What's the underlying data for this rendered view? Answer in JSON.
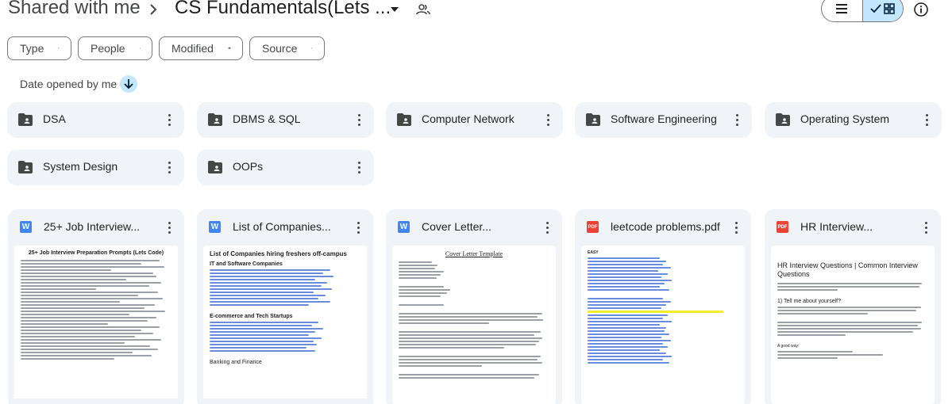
{
  "header": {
    "root": "Shared with me",
    "current": "CS Fundamentals(Lets ..."
  },
  "filters": [
    "Type",
    "People",
    "Modified",
    "Source"
  ],
  "sort": {
    "label": "Date opened by me"
  },
  "folders": [
    {
      "name": "DSA"
    },
    {
      "name": "DBMS & SQL"
    },
    {
      "name": "Computer Network"
    },
    {
      "name": "Software Engineering"
    },
    {
      "name": "Operating System"
    },
    {
      "name": "System Design"
    },
    {
      "name": "OOPs"
    }
  ],
  "files": [
    {
      "name": "25+ Job Interview...",
      "type": "doc",
      "type_label": "W",
      "thumb_title": "25+ Job Interview Preparation Prompts (Lets Code)"
    },
    {
      "name": "List of Companies...",
      "type": "doc",
      "type_label": "W",
      "thumb_title": "List of Companies hiring freshers off-campus",
      "thumb_sections": [
        "IT and Software Companies",
        "E-commerce and Tech Startups"
      ],
      "thumb_footer": "Banking and Finance"
    },
    {
      "name": "Cover Letter...",
      "type": "doc",
      "type_label": "W",
      "thumb_title": "Cover Letter Template"
    },
    {
      "name": "leetcode problems.pdf",
      "type": "pdf",
      "type_label": "PDF",
      "thumb_title": "EASY"
    },
    {
      "name": "HR Interview...",
      "type": "pdf",
      "type_label": "PDF",
      "thumb_title": "HR Interview Questions | Common Interview Questions",
      "thumb_q": "1) Tell me about yourself?",
      "thumb_good": "A good way:"
    }
  ],
  "colors": {
    "card_bg": "#f0f4f9",
    "selected": "#c2e7ff",
    "doc_icon": "#4285f4",
    "pdf_icon": "#ea4335"
  }
}
